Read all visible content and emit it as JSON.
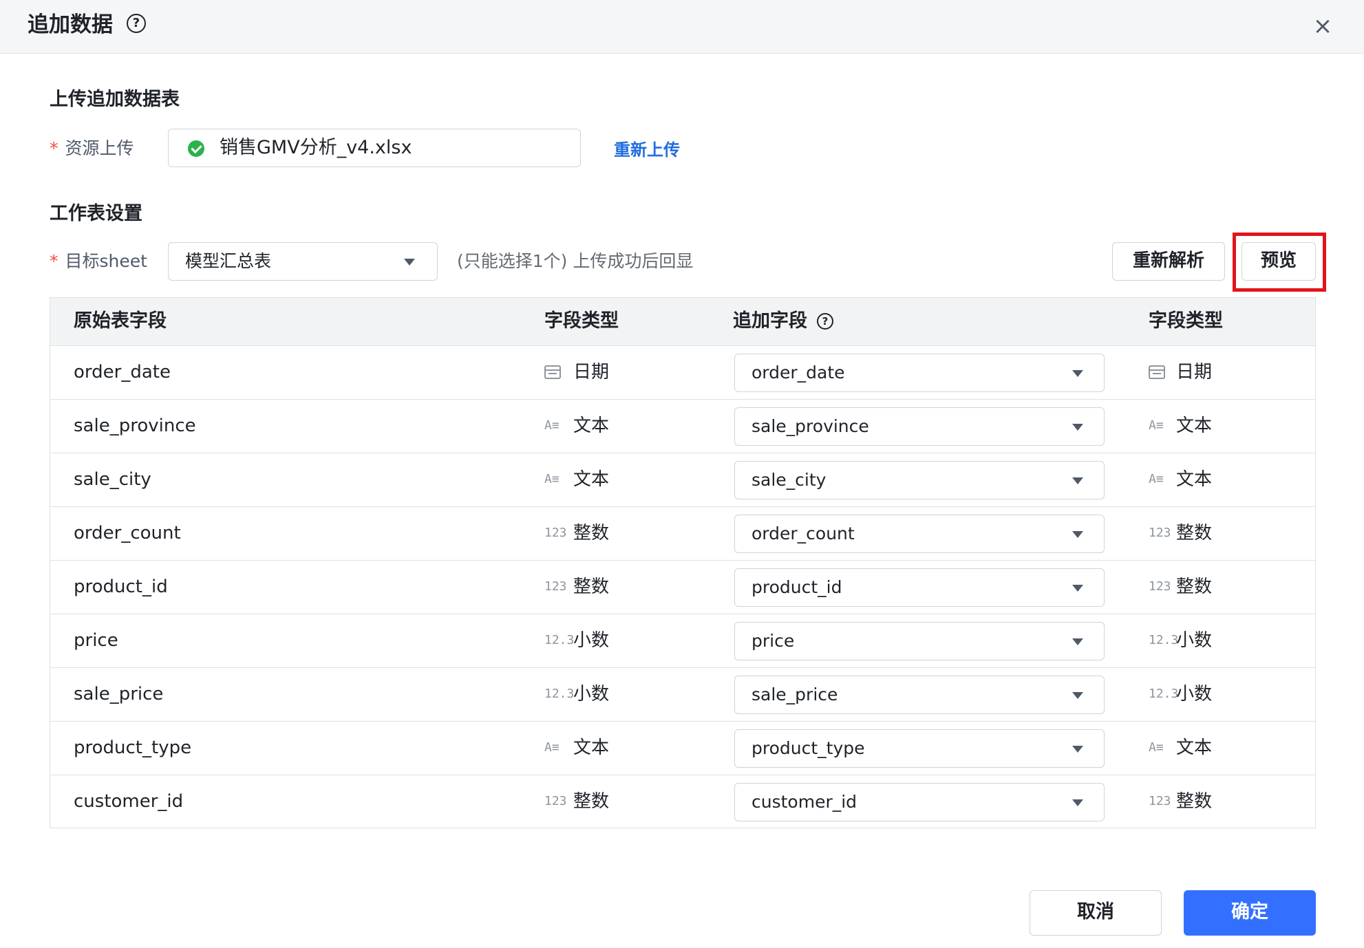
{
  "dialog": {
    "title": "追加数据",
    "help_icon": "?",
    "close_icon": "×"
  },
  "upload_section": {
    "title": "上传追加数据表",
    "required_mark": "*",
    "label": "资源上传",
    "file_name": "销售GMV分析_v4.xlsx",
    "reupload_label": "重新上传"
  },
  "sheet_section": {
    "title": "工作表设置",
    "required_mark": "*",
    "label": "目标sheet",
    "selected_sheet": "模型汇总表",
    "hint": "(只能选择1个) 上传成功后回显",
    "reparse_label": "重新解析",
    "preview_label": "预览"
  },
  "table": {
    "headers": {
      "source_field": "原始表字段",
      "source_type": "字段类型",
      "target_field": "追加字段",
      "target_type": "字段类型"
    },
    "rows": [
      {
        "source": "order_date",
        "type_icon": "calendar",
        "type": "日期",
        "target": "order_date",
        "target_type": "日期"
      },
      {
        "source": "sale_province",
        "type_icon": "A≡",
        "type": "文本",
        "target": "sale_province",
        "target_type": "文本"
      },
      {
        "source": "sale_city",
        "type_icon": "A≡",
        "type": "文本",
        "target": "sale_city",
        "target_type": "文本"
      },
      {
        "source": "order_count",
        "type_icon": "123",
        "type": "整数",
        "target": "order_count",
        "target_type": "整数"
      },
      {
        "source": "product_id",
        "type_icon": "123",
        "type": "整数",
        "target": "product_id",
        "target_type": "整数"
      },
      {
        "source": "price",
        "type_icon": "12.3",
        "type": "小数",
        "target": "price",
        "target_type": "小数"
      },
      {
        "source": "sale_price",
        "type_icon": "12.3",
        "type": "小数",
        "target": "sale_price",
        "target_type": "小数"
      },
      {
        "source": "product_type",
        "type_icon": "A≡",
        "type": "文本",
        "target": "product_type",
        "target_type": "文本"
      },
      {
        "source": "customer_id",
        "type_icon": "123",
        "type": "整数",
        "target": "customer_id",
        "target_type": "整数"
      }
    ]
  },
  "footer": {
    "cancel_label": "取消",
    "confirm_label": "确定"
  },
  "colors": {
    "primary": "#3370ff",
    "link": "#1f6ddf",
    "required": "#f54a45",
    "success": "#2db14e",
    "highlight": "#e3141b"
  }
}
